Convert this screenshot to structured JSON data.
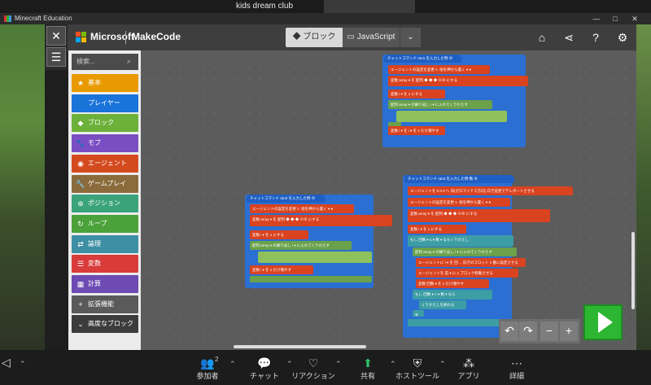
{
  "meeting": {
    "participant_name": "kids dream club"
  },
  "window": {
    "title": "Minecraft Education",
    "controls": [
      "—",
      "□",
      "✕"
    ]
  },
  "header": {
    "brand": "Microsoft",
    "product": "MakeCode",
    "tab_blocks": "ブロック",
    "tab_js": "JavaScript",
    "icons": [
      "home-icon",
      "share-icon",
      "help-icon",
      "settings-icon"
    ]
  },
  "toolbox": {
    "search_placeholder": "検索...",
    "categories": [
      {
        "label": "基本",
        "icon": "★",
        "color": "#e89a00"
      },
      {
        "label": "プレイヤー",
        "icon": "👤",
        "color": "#1a73d9"
      },
      {
        "label": "ブロック",
        "icon": "◆",
        "color": "#6cb13a"
      },
      {
        "label": "モブ",
        "icon": "🐾",
        "color": "#7a4ec2"
      },
      {
        "label": "エージェント",
        "icon": "◉",
        "color": "#d44a1f"
      },
      {
        "label": "ゲームプレイ",
        "icon": "🔧",
        "color": "#8b6b3c"
      },
      {
        "label": "ポジション",
        "icon": "⊕",
        "color": "#3aa37a"
      },
      {
        "label": "ループ",
        "icon": "↻",
        "color": "#4ca23a"
      },
      {
        "label": "論理",
        "icon": "⇄",
        "color": "#3d8fa3"
      },
      {
        "label": "変数",
        "icon": "☰",
        "color": "#d93b3b"
      },
      {
        "label": "計算",
        "icon": "▦",
        "color": "#6d4bb3"
      },
      {
        "label": "拡張機能",
        "icon": "+",
        "color": "#5a5a5a"
      },
      {
        "label": "高度なブロック",
        "icon": "⌄",
        "color": "#3c3c3c"
      }
    ]
  },
  "blocks": {
    "s1_hat": "チャットコマンド  ran1  を入力した時  ⊕",
    "s1": [
      "エージェントの設定を変更  1. 他を押から置く ▾  ●",
      "変数 array ▾ を  配列  ◆ ◆ ◆  ⊖⊕  にする",
      "変数 i ▾ を  1  にする",
      "配列 array ▾ の繰り返し  i ▾  に入れてくりかえす",
      "変数 i ▾ を  i ▾  を  1  だけ増やす"
    ],
    "s2_hat": "チャットコマンド  ran2  を入力した時  ⊕",
    "s2": [
      "エージェントの設定を変更  1. 他を押から置く ▾  ●",
      "変数 array ▾ を  配列  ◆ ◆ ◆  ⊖⊕  にする",
      "変数 i ▾ を  1  にする",
      "配列 array ▾ の繰り返し  i ▾  に入れてくりかえす",
      "変数 i ▾ を  1  だけ増やす"
    ],
    "s3_hat": "チャットコマンド  ran3  を入力した時  数 ⊕",
    "s3": [
      "エージェントを  0  0  0  へ 向(ゼロマイナス方向) 向き変更でテレポートさせる",
      "エージェントの設定を変更  1. 他を押から置く ▾  ●",
      "変数 array ▾ を  配列  ◆ ◆ ◆  ⊖⊕  にする",
      "変数 i ▾ を  1  にする",
      "もし  回数 ▾  ≤ ▾  数 ▾  ならくりかえし",
      "配列 array ▾ の繰り返し  i ▾  に入れてくりかえす",
      "エージェントに  i ▾  を 回 ... 向きのスロット  1  番に設定させる",
      "エージェントを  前 ▾  に  1  ブロック移動させる",
      "変数 回数 ▾ を  1  だけ増やす",
      "もし  回数 ▾  < ▾  数 ▾  なら",
      "くりかえしを終わる"
    ]
  },
  "zoom_toolbar": {
    "items": [
      {
        "label": "参加者",
        "icon": "participants-icon",
        "glyph": "👥",
        "badge": "2"
      },
      {
        "label": "チャット",
        "icon": "chat-icon",
        "glyph": "💬"
      },
      {
        "label": "リアクション",
        "icon": "reaction-icon",
        "glyph": "♡"
      },
      {
        "label": "共有",
        "icon": "share-screen-icon",
        "glyph": "⬆"
      },
      {
        "label": "ホストツール",
        "icon": "shield-icon",
        "glyph": "⛨"
      },
      {
        "label": "アプリ",
        "icon": "apps-icon",
        "glyph": "⁂"
      },
      {
        "label": "詳細",
        "icon": "more-icon",
        "glyph": "⋯"
      }
    ]
  }
}
